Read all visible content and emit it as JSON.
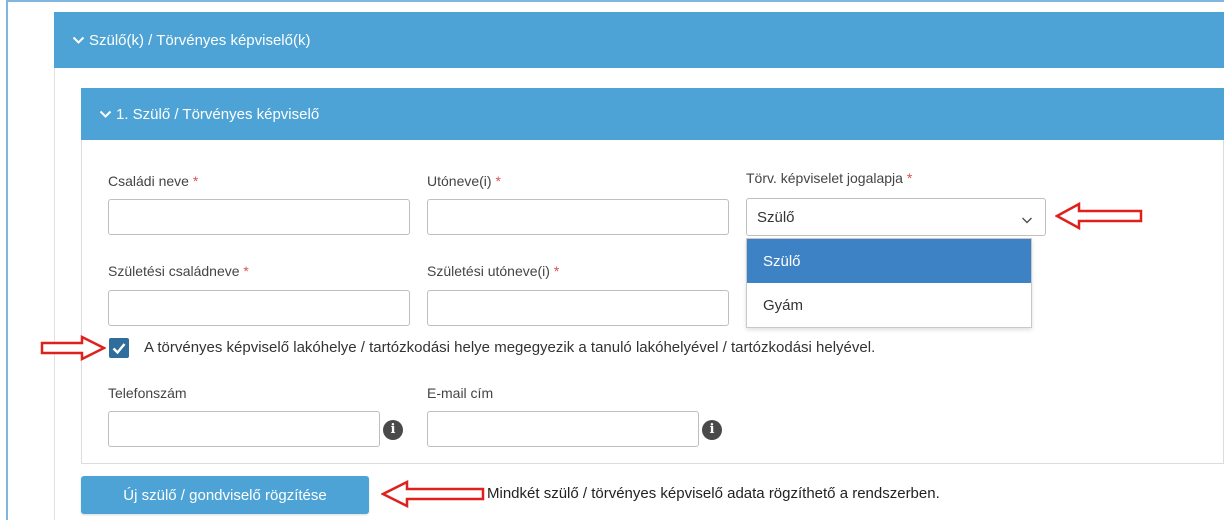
{
  "section": {
    "parents_title": "Szülő(k) / Törvényes képviselő(k)",
    "parent1_title": "1. Szülő / Törvényes képviselő"
  },
  "fields": {
    "family_name": {
      "label": "Családi neve",
      "required": "*",
      "value": ""
    },
    "given_name": {
      "label": "Utóneve(i)",
      "required": "*",
      "value": ""
    },
    "legal_basis": {
      "label": "Törv. képviselet jogalapja",
      "required": "*",
      "value": "Szülő"
    },
    "birth_family_name": {
      "label": "Születési családneve",
      "required": "*",
      "value": ""
    },
    "birth_given_name": {
      "label": "Születési utóneve(i)",
      "required": "*",
      "value": ""
    },
    "phone": {
      "label": "Telefonszám",
      "value": ""
    },
    "email": {
      "label": "E-mail cím",
      "value": ""
    }
  },
  "dropdown": {
    "options": [
      "Szülő",
      "Gyám"
    ],
    "selected": "Szülő"
  },
  "checkbox": {
    "checked": true,
    "label": "A törvényes képviselő lakóhelye / tartózkodási helye megegyezik a tanuló lakóhelyével / tartózkodási helyével."
  },
  "actions": {
    "new_parent_label": "Új szülő / gondviselő rögzítése"
  },
  "annotation": {
    "note": "Mindkét szülő / törvényes képviselő adata rögzíthető a rendszerben."
  },
  "colors": {
    "header_blue": "#4da3d5",
    "selected_option": "#3d82c4",
    "required_star": "#d9534f",
    "arrow_red": "#e0201c"
  },
  "icons": {
    "info": "i"
  }
}
